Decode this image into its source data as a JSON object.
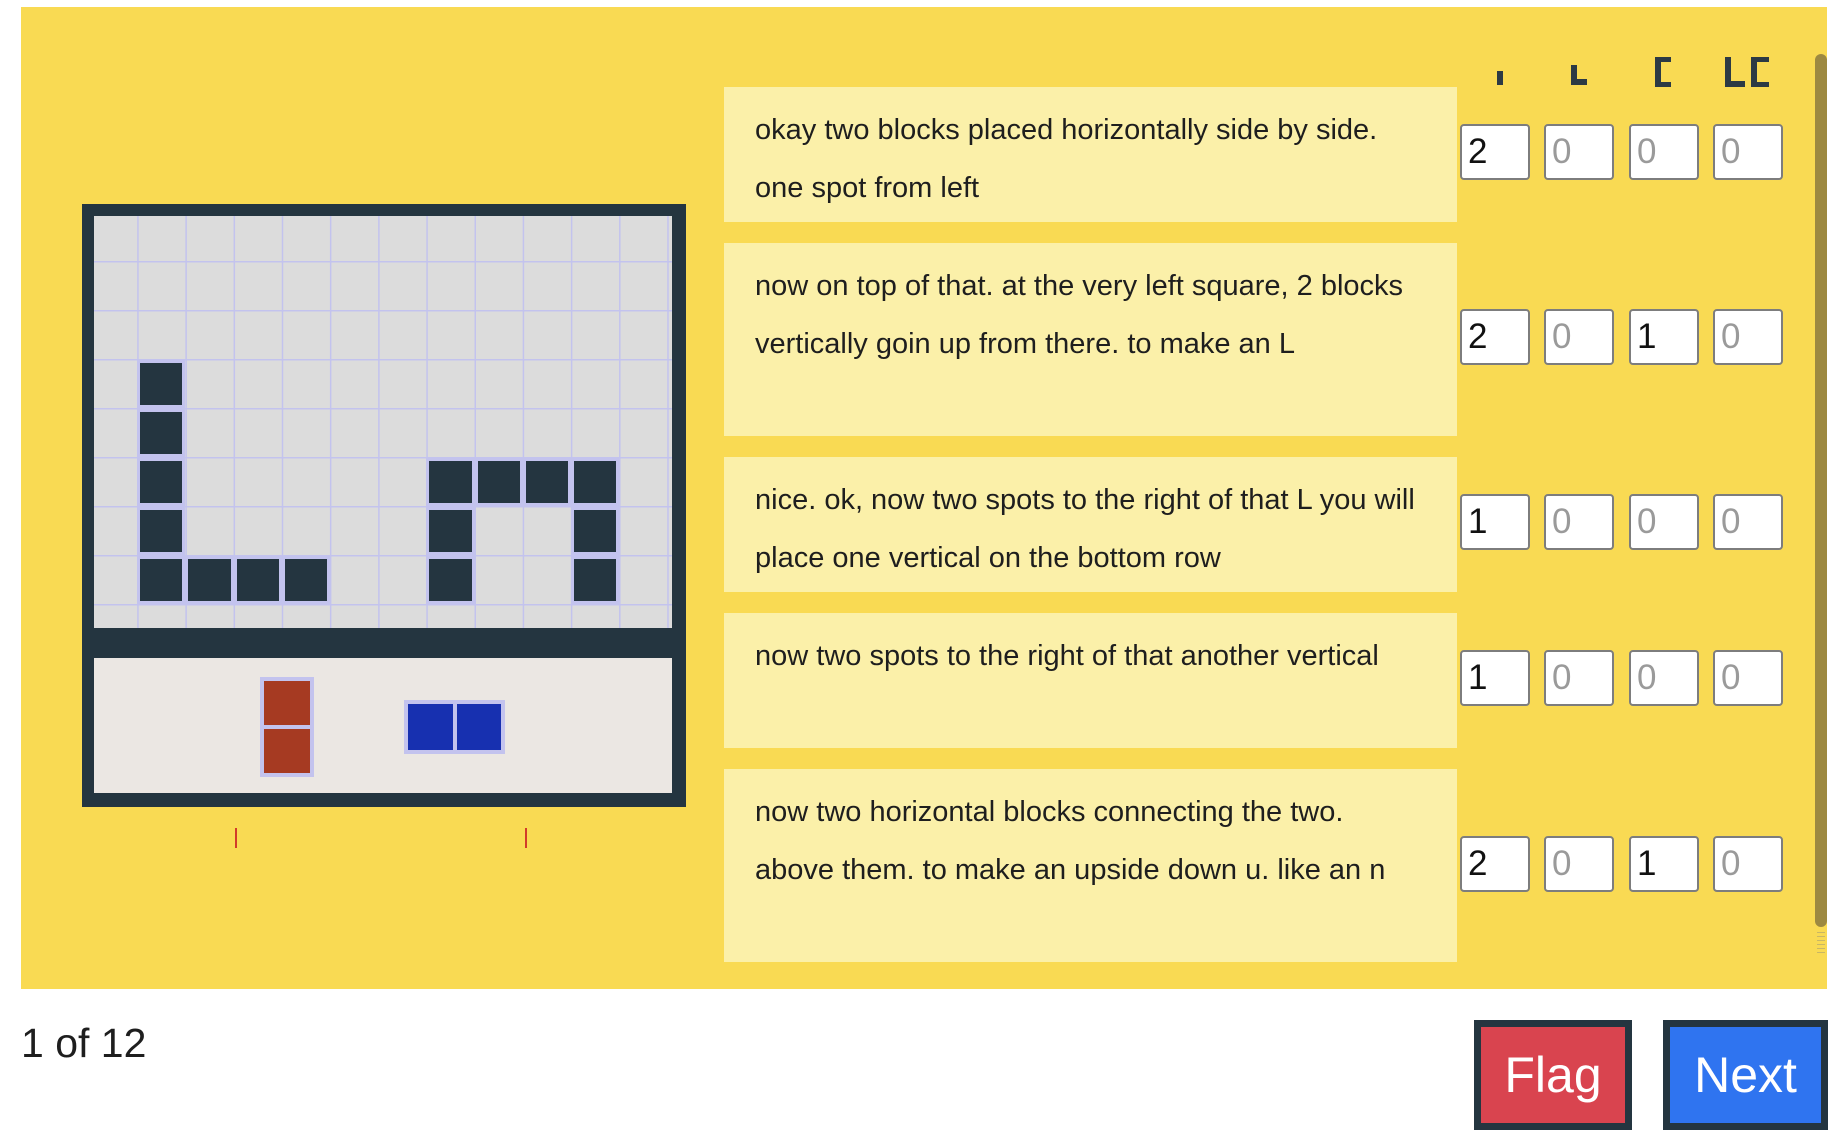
{
  "instructions": [
    {
      "text": "okay two blocks placed horizontally side by side. one spot from left",
      "counts": [
        2,
        0,
        0,
        0
      ]
    },
    {
      "text": "now on top of that. at the very left square, 2 blocks vertically goin up from there. to make an L",
      "counts": [
        2,
        0,
        1,
        0
      ]
    },
    {
      "text": "nice. ok, now two spots to the right of that L you will place one vertical on the bottom row",
      "counts": [
        1,
        0,
        0,
        0
      ]
    },
    {
      "text": "now two spots to the right of that another vertical",
      "counts": [
        1,
        0,
        0,
        0
      ]
    },
    {
      "text": "now two horizontal blocks connecting the two. above them. to make an upside down u. like an n",
      "counts": [
        2,
        0,
        1,
        0
      ]
    }
  ],
  "column_icons": [
    "single-block-icon",
    "l-shape-icon",
    "bracket-icon",
    "l-bracket-icon"
  ],
  "board": {
    "placed_cells": [
      [
        1,
        3
      ],
      [
        1,
        4
      ],
      [
        1,
        5
      ],
      [
        1,
        6
      ],
      [
        1,
        7
      ],
      [
        2,
        7
      ],
      [
        3,
        7
      ],
      [
        4,
        7
      ],
      [
        7,
        5
      ],
      [
        8,
        5
      ],
      [
        9,
        5
      ],
      [
        10,
        5
      ],
      [
        7,
        6
      ],
      [
        7,
        7
      ],
      [
        10,
        6
      ],
      [
        10,
        7
      ]
    ],
    "tray_pieces": [
      {
        "orientation": "vertical",
        "color": "#a63a22"
      },
      {
        "orientation": "horizontal",
        "color": "#1730b0"
      }
    ]
  },
  "footer": {
    "counter": "1 of 12",
    "flag_label": "Flag",
    "next_label": "Next"
  },
  "colors": {
    "panel": "#f9da53",
    "instruction_bg": "#fbf0a9",
    "flag": "#d9444f",
    "next": "#2f74f0"
  }
}
